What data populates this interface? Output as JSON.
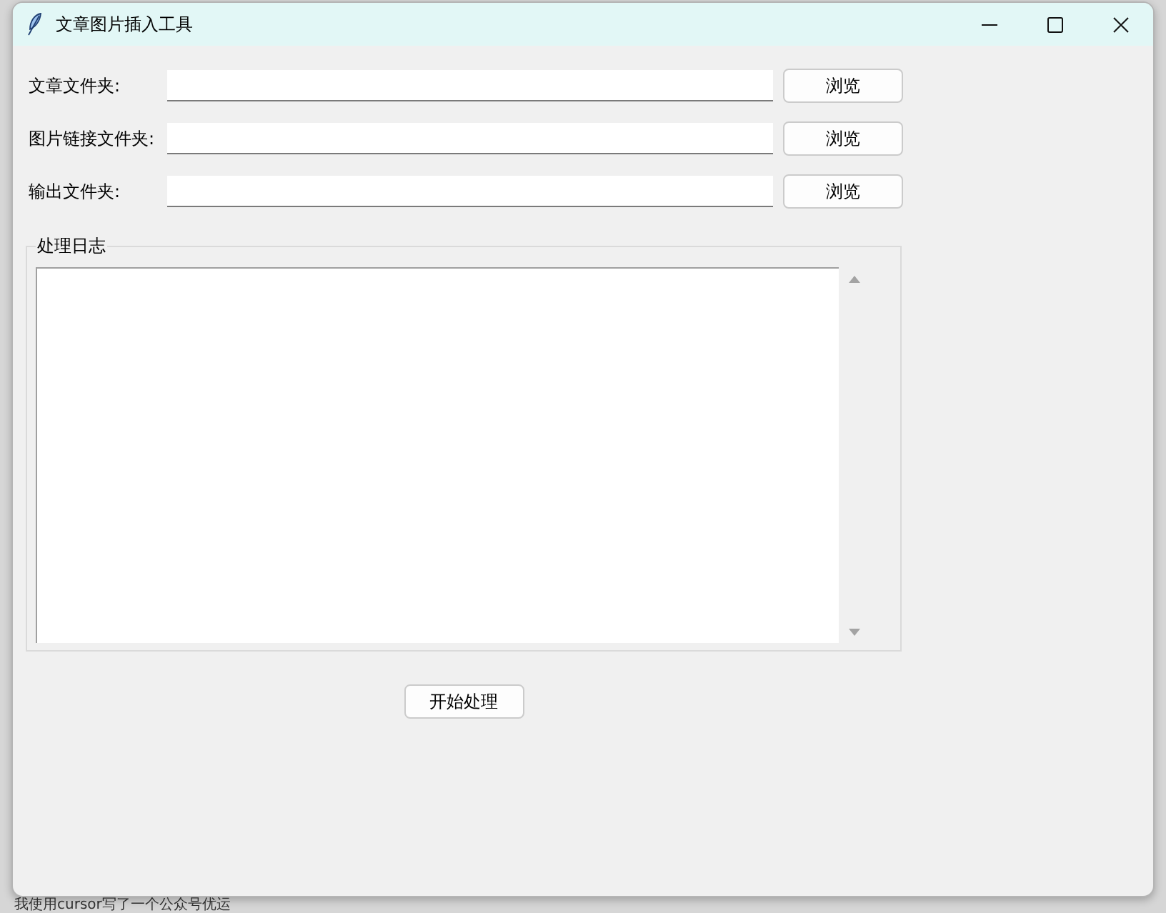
{
  "window": {
    "title": "文章图片插入工具"
  },
  "folders": [
    {
      "label": "文章文件夹:",
      "button": "浏览"
    },
    {
      "label": "图片链接文件夹:",
      "button": "浏览"
    },
    {
      "label": "输出文件夹:",
      "button": "浏览"
    }
  ],
  "log": {
    "title": "处理日志"
  },
  "start_button": {
    "label": "开始处理"
  },
  "background": {
    "text": "我使用cursor写了一个公众号优运"
  }
}
